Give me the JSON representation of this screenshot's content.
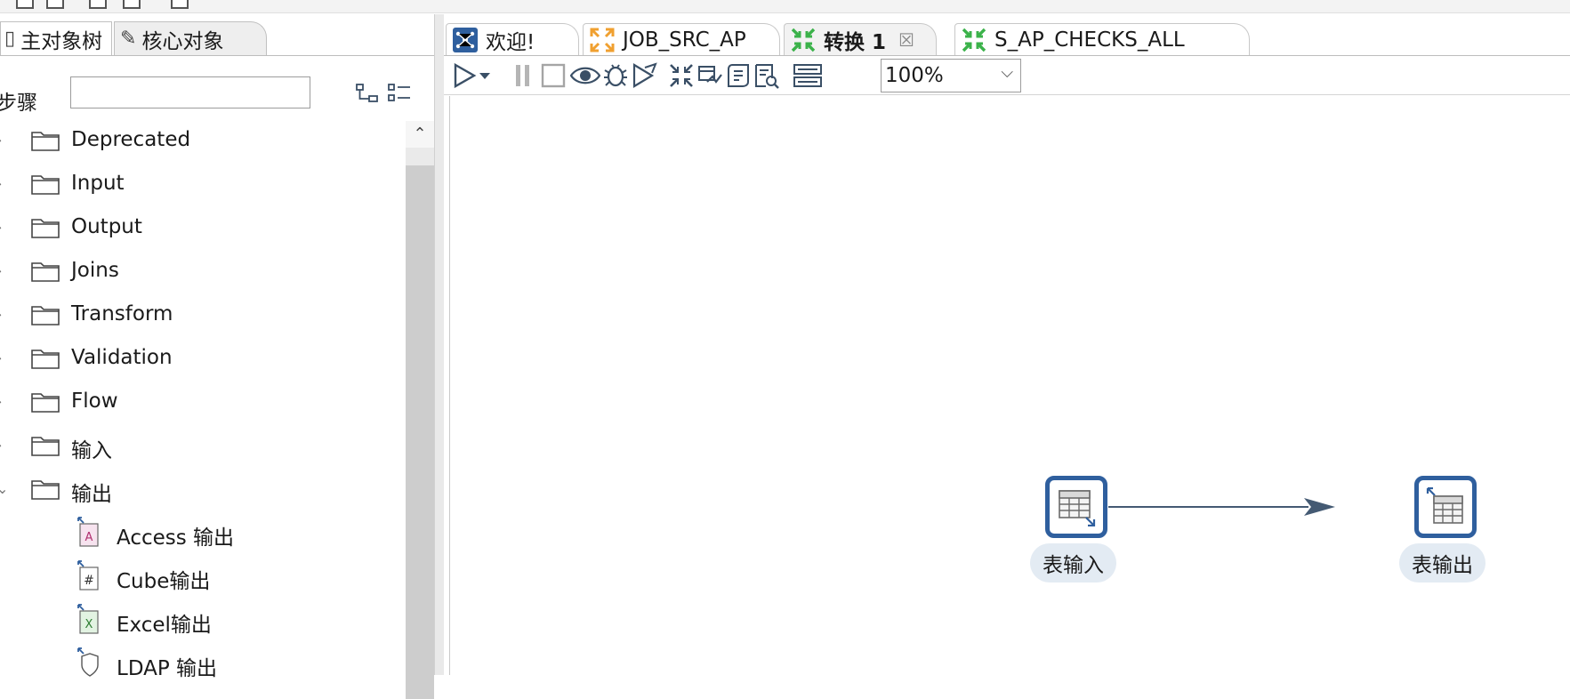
{
  "left_panel": {
    "tabs": {
      "main": "主对象树",
      "core": "核心对象"
    },
    "search_label": "步骤",
    "search_value": "",
    "tree": {
      "folders": [
        "Deprecated",
        "Input",
        "Output",
        "Joins",
        "Transform",
        "Validation",
        "Flow",
        "输入",
        "输出"
      ],
      "children": [
        "Access 输出",
        "Cube输出",
        "Excel输出",
        "LDAP 输出"
      ]
    }
  },
  "editor": {
    "tabs": [
      "欢迎!",
      "JOB_SRC_AP",
      "转换 1",
      "S_AP_CHECKS_ALL"
    ],
    "active_tab": "转换 1",
    "zoom": "100%",
    "canvas": {
      "steps": {
        "input": "表输入",
        "output": "表输出"
      }
    }
  },
  "colors": {
    "step_border": "#2f5f9e",
    "step_label_bg": "#e3ebf3",
    "hop": "#445a73",
    "job_orange": "#f0a030",
    "trans_green": "#3bb24a",
    "welcome_blue": "#2f5f9e"
  },
  "icons": {
    "toolbar": [
      "run-icon",
      "run-dropdown-icon",
      "pause-icon",
      "stop-icon",
      "preview-icon",
      "debug-icon",
      "replay-icon",
      "verify-icon",
      "analyze-icon",
      "sql-icon",
      "explore-db-icon",
      "show-results-icon"
    ]
  }
}
